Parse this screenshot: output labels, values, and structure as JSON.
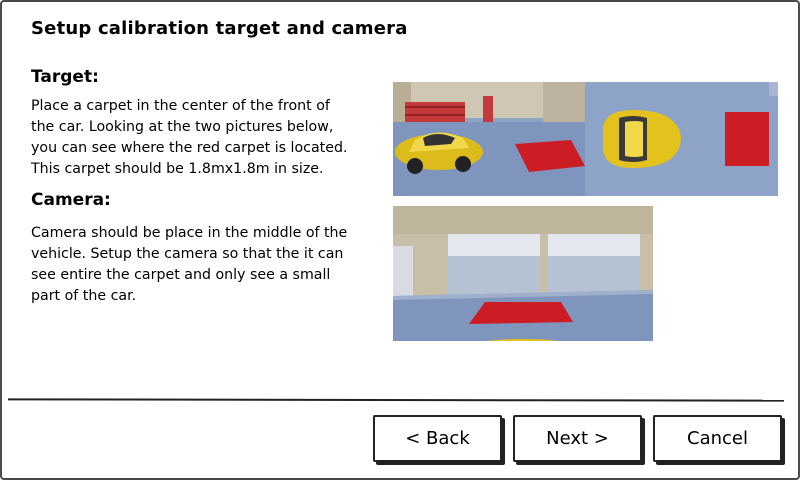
{
  "dialog": {
    "title": "Setup calibration target and camera"
  },
  "target": {
    "heading": "Target:",
    "text": "Place a carpet in the center of the front of\nthe car. Looking at the two pictures below,\nyou can see where the red carpet is located.\nThis carpet should be 1.8mx1.8m in size."
  },
  "camera": {
    "heading": "Camera:",
    "text": "Camera should be place in the middle of the\nvehicle. Setup the camera so that the it can\nsee entire the carpet and only see a small\npart of the car."
  },
  "buttons": {
    "back": "< Back",
    "next": "Next >",
    "cancel": "Cancel"
  },
  "colors": {
    "carpet": "#cc1c24",
    "car": "#e3c21e",
    "floor": "#7a90b8",
    "wall": "#cfc6b4"
  }
}
